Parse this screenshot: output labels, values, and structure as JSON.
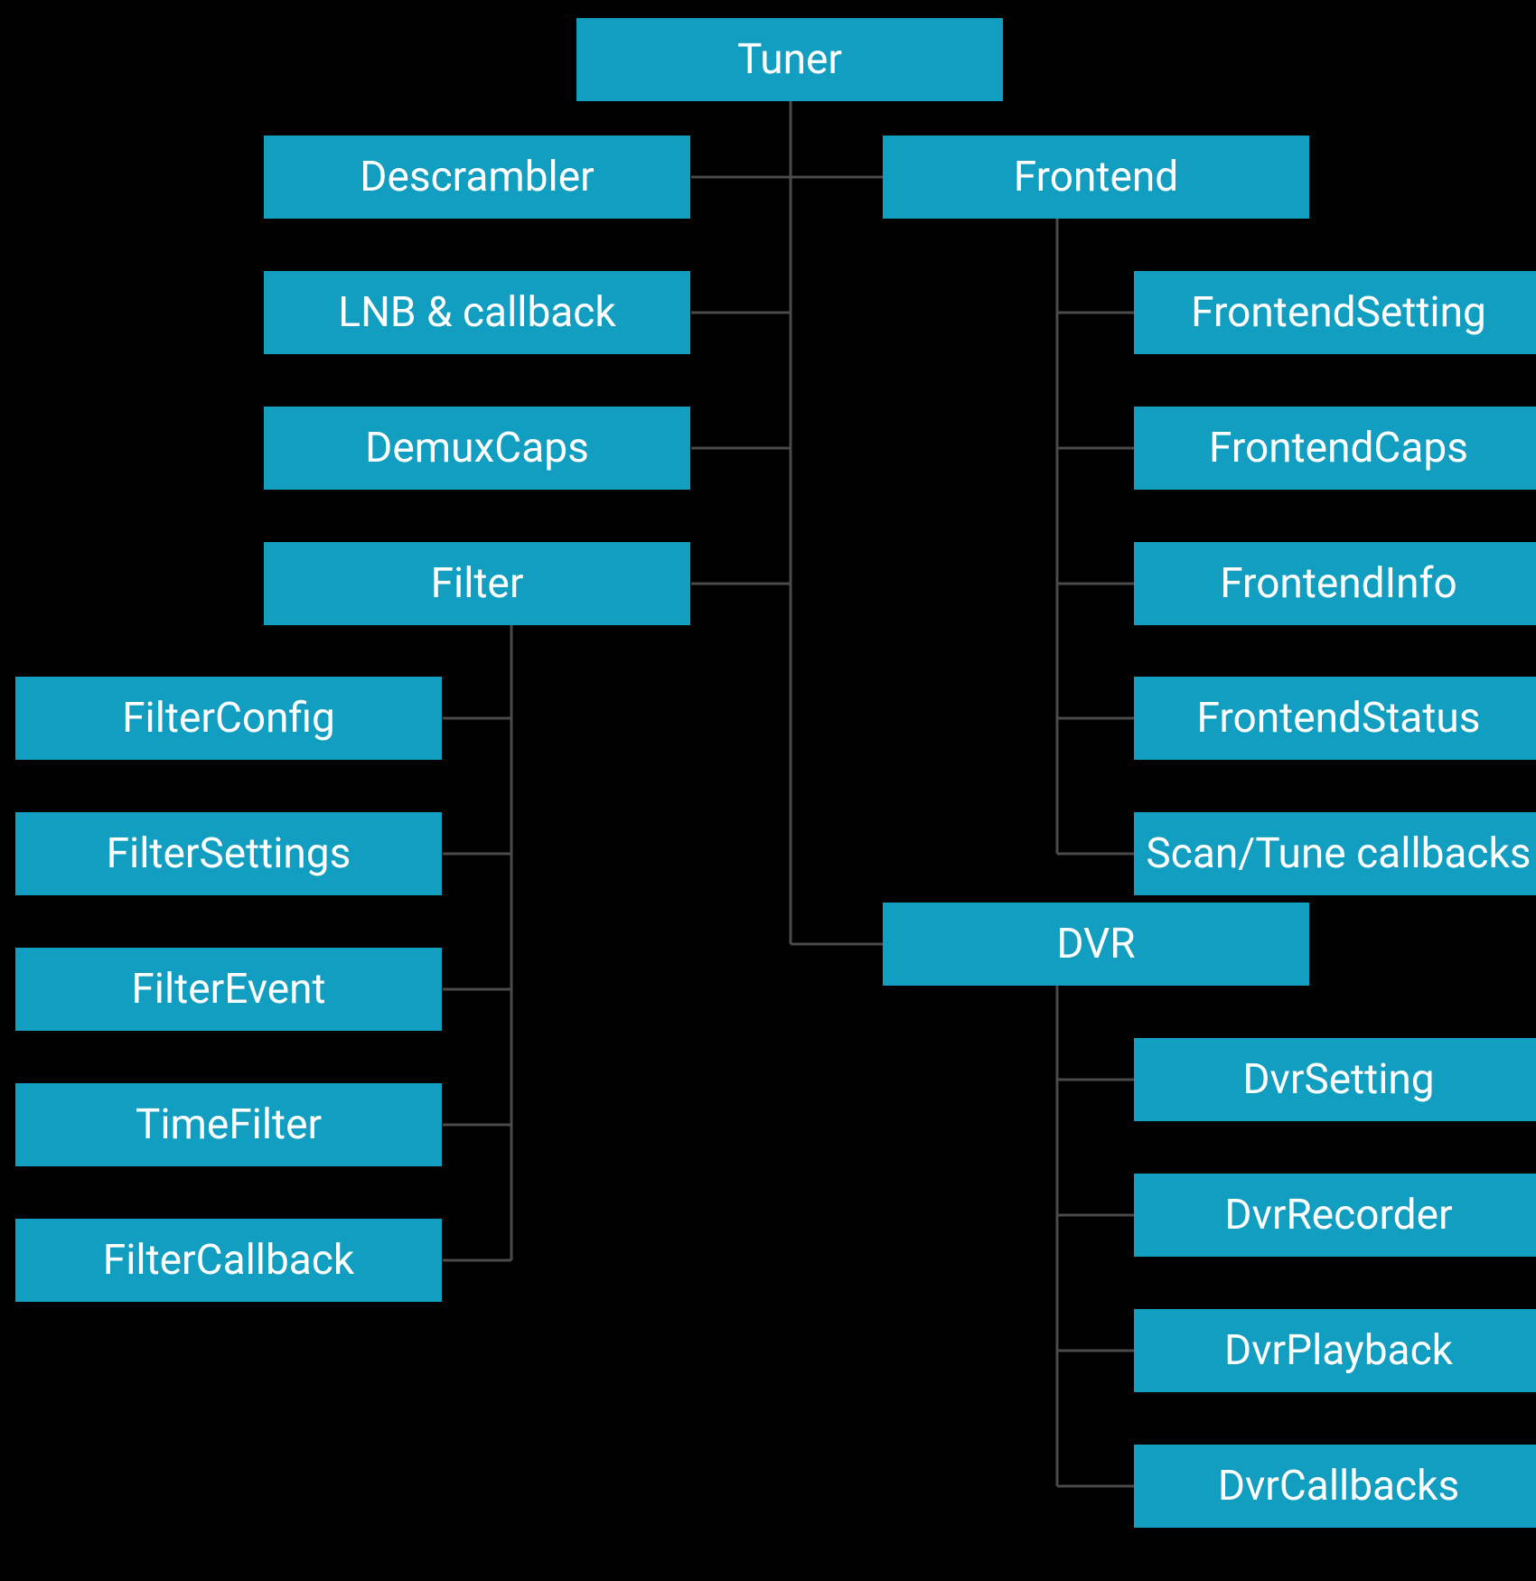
{
  "colors": {
    "node_bg": "#129ec0",
    "node_fg": "#ffffff",
    "line": "#4a4a4a",
    "bg": "#000000"
  },
  "root": {
    "label": "Tuner"
  },
  "left_children": {
    "descrambler": {
      "label": "Descrambler"
    },
    "lnb": {
      "label": "LNB & callback"
    },
    "demuxcaps": {
      "label": "DemuxCaps"
    },
    "filter": {
      "label": "Filter",
      "children": {
        "filterconfig": {
          "label": "FilterConfig"
        },
        "filtersettings": {
          "label": "FilterSettings"
        },
        "filterevent": {
          "label": "FilterEvent"
        },
        "timefilter": {
          "label": "TimeFilter"
        },
        "filtercallback": {
          "label": "FilterCallback"
        }
      }
    }
  },
  "right_children": {
    "frontend": {
      "label": "Frontend",
      "children": {
        "frontendsetting": {
          "label": "FrontendSetting"
        },
        "frontendcaps": {
          "label": "FrontendCaps"
        },
        "frontendinfo": {
          "label": "FrontendInfo"
        },
        "frontendstatus": {
          "label": "FrontendStatus"
        },
        "scantune": {
          "label": "Scan/Tune callbacks"
        }
      }
    },
    "dvr": {
      "label": "DVR",
      "children": {
        "dvrsetting": {
          "label": "DvrSetting"
        },
        "dvrrecorder": {
          "label": "DvrRecorder"
        },
        "dvrplayback": {
          "label": "DvrPlayback"
        },
        "dvrcallbacks": {
          "label": "DvrCallbacks"
        }
      }
    }
  }
}
